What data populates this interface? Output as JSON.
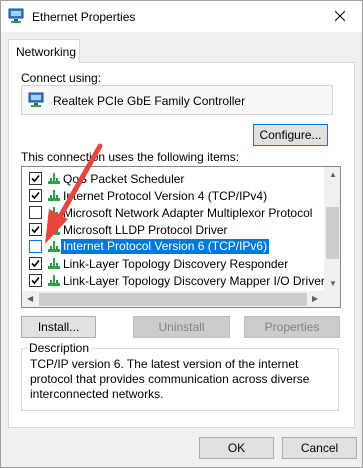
{
  "window": {
    "title": "Ethernet Properties",
    "close_label": "✕"
  },
  "tabs": [
    {
      "label": "Networking"
    }
  ],
  "connect_using": {
    "label": "Connect using:",
    "adapter_name": "Realtek PCIe GbE Family Controller"
  },
  "configure_label": "Configure...",
  "items_label": "This connection uses the following items:",
  "items": [
    {
      "label": "QoS Packet Scheduler",
      "checked": true
    },
    {
      "label": "Internet Protocol Version 4 (TCP/IPv4)",
      "checked": true
    },
    {
      "label": "Microsoft Network Adapter Multiplexor Protocol",
      "checked": false
    },
    {
      "label": "Microsoft LLDP Protocol Driver",
      "checked": true
    },
    {
      "label": "Internet Protocol Version 6 (TCP/IPv6)",
      "checked": false,
      "selected": true
    },
    {
      "label": "Link-Layer Topology Discovery Responder",
      "checked": true
    },
    {
      "label": "Link-Layer Topology Discovery Mapper I/O Driver",
      "checked": true
    }
  ],
  "buttons": {
    "install": "Install...",
    "uninstall": "Uninstall",
    "properties": "Properties",
    "ok": "OK",
    "cancel": "Cancel"
  },
  "description": {
    "legend": "Description",
    "text": "TCP/IP version 6. The latest version of the internet protocol that provides communication across diverse interconnected networks."
  },
  "colors": {
    "selection": "#0078d7",
    "annotation_arrow": "#e8453c"
  },
  "icons": {
    "title": "network-adapter-icon",
    "adapter": "network-adapter-icon",
    "item": "network-component-icon"
  }
}
